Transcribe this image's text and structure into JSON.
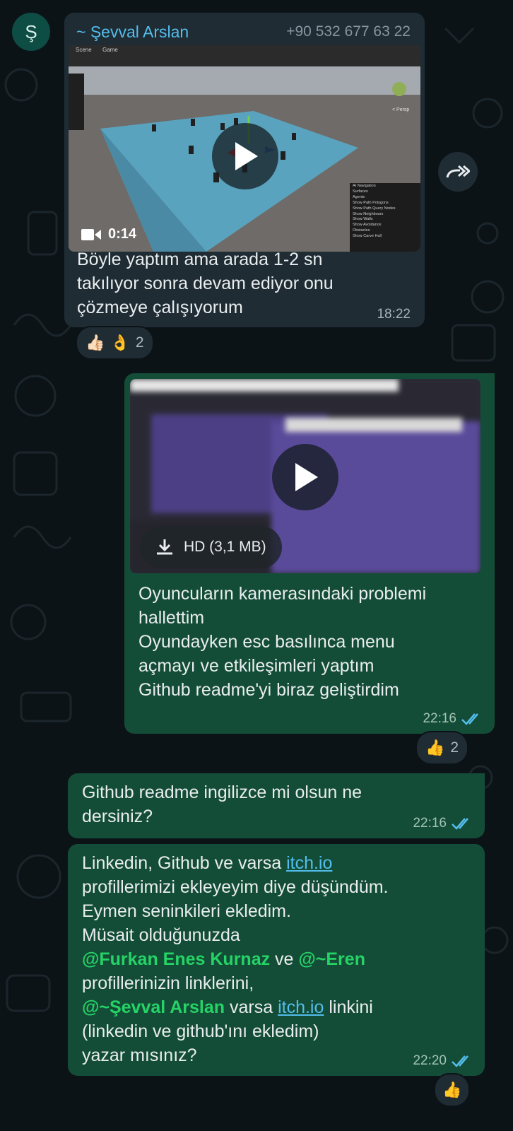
{
  "sender": {
    "avatar_letter": "Ş",
    "name": "~ Şevval Arslan",
    "phone": "+90 532 677 63 22"
  },
  "messages": [
    {
      "direction": "incoming",
      "video": {
        "duration": "0:14",
        "editor_labels": {
          "scene_tab": "Scene",
          "game_tab": "Game",
          "persp": "< Persp",
          "ai_panel": [
            "AI Navigation",
            "Surfaces",
            "Agents",
            "Show Path Polygons",
            "Show Path Query Nodes",
            "Show Neighbours",
            "Show Walls",
            "Show Avoidance",
            "Obstacles",
            "Show Carve Hull"
          ]
        }
      },
      "text": "Böyle yaptım ama arada 1-2 sn\ntakılıyor sonra devam ediyor onu\nçözmeye çalışıyorum",
      "time": "18:22",
      "reactions": {
        "emojis": [
          "👍🏻",
          "👌"
        ],
        "count": "2"
      }
    },
    {
      "direction": "outgoing",
      "video": {
        "download_label": "HD (3,1 MB)"
      },
      "text": "Oyuncuların kamerasındaki problemi\nhallettim\nOyundayken esc basılınca menu\naçmayı ve etkileşimleri yaptım\nGithub readme'yi biraz geliştirdim",
      "time": "22:16",
      "reactions": {
        "emojis": [
          "👍"
        ],
        "count": "2"
      }
    },
    {
      "direction": "outgoing",
      "text": "Github readme ingilizce mi olsun ne\ndersiniz?",
      "time": "22:16"
    },
    {
      "direction": "outgoing",
      "parts": {
        "p1": "Linkedin, Github ve varsa ",
        "link1": "itch.io",
        "p2": "\nprofillerimizi ekleyeyim diye düşündüm.\nEymen seninkileri ekledim.\nMüsait olduğunuzda\n",
        "mention1": "@Furkan Enes Kurnaz",
        "p3": " ve ",
        "mention2": "@~Eren",
        "p4": "\nprofillerinizin linklerini,\n",
        "mention3": "@~Şevval Arslan",
        "p5": " varsa ",
        "link2": "itch.io",
        "p6": " linkini\n(linkedin ve github'ını ekledim)\nyazar mısınız?"
      },
      "time": "22:20",
      "reactions": {
        "emojis": [
          "👍"
        ]
      }
    }
  ],
  "colors": {
    "background": "#0c1317",
    "incoming_bubble": "#1f2c34",
    "outgoing_bubble": "#144d37",
    "mention": "#25d366",
    "link": "#53bdeb",
    "read_ticks": "#53bdeb"
  }
}
